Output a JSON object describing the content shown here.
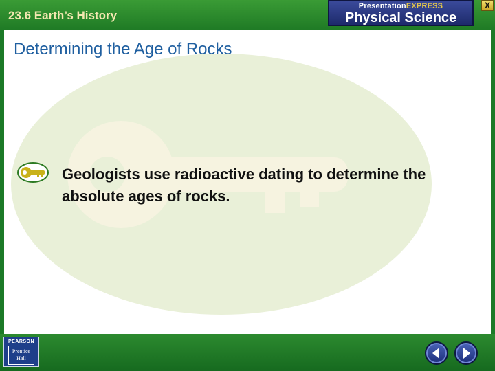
{
  "header": {
    "section_title": "23.6 Earth’s History",
    "brand_top_prefix": "Presentation",
    "brand_top_suffix": "EXPRESS",
    "brand_main": "Physical Science",
    "close_label": "X"
  },
  "slide": {
    "heading": "Determining the Age of Rocks",
    "bullets": [
      {
        "icon": "key-icon",
        "text": "Geologists use radioactive dating to determine the absolute ages of rocks."
      }
    ]
  },
  "footer": {
    "publisher": "PEARSON",
    "imprint_line1": "Prentice",
    "imprint_line2": "Hall",
    "nav_prev": "previous-arrow-icon",
    "nav_next": "next-arrow-icon"
  },
  "colors": {
    "frame_green": "#1c7a27",
    "heading_blue": "#1f5fa0",
    "brand_blue": "#2a3a8a",
    "key_gold": "#c9b21a"
  }
}
